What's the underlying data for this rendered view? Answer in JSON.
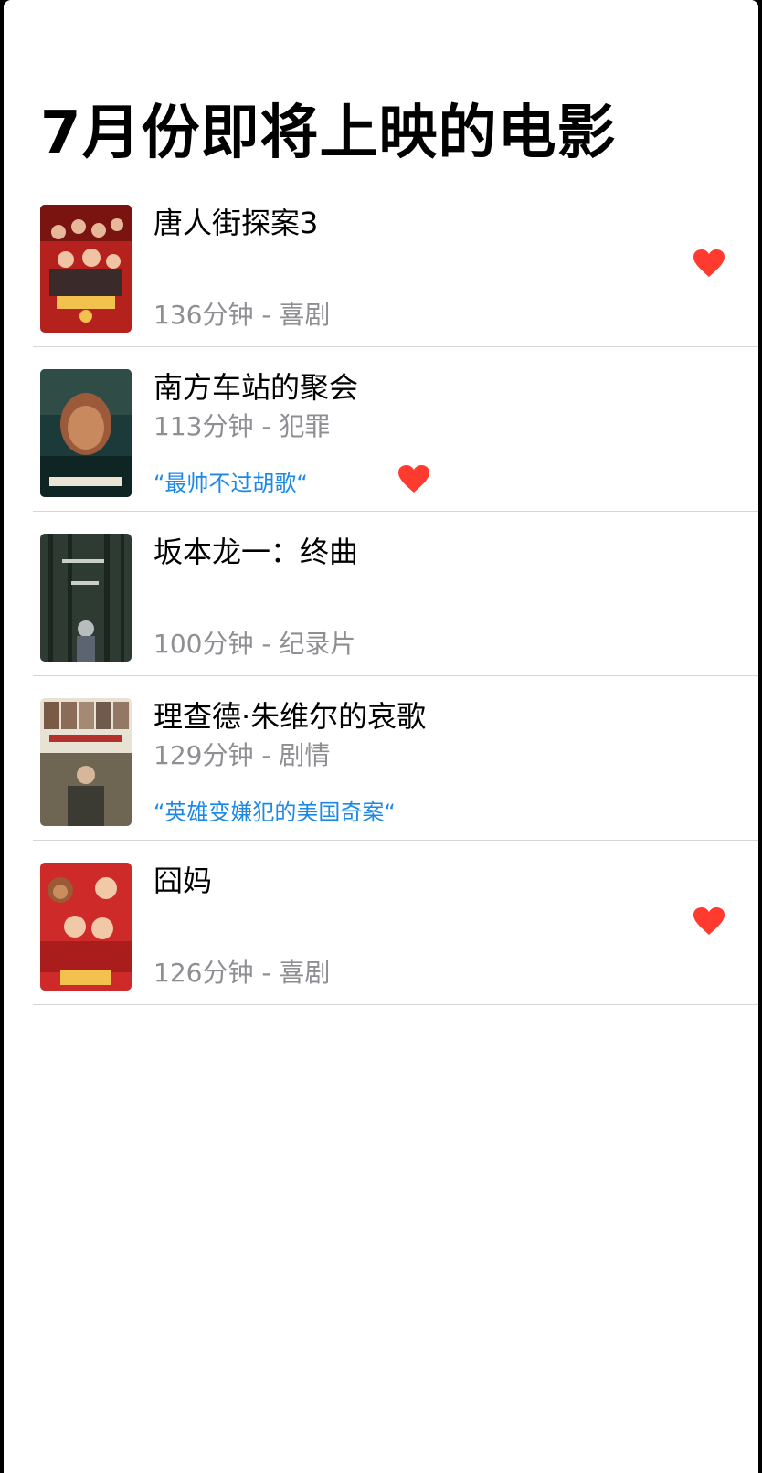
{
  "page": {
    "title": "7月份即将上映的电影"
  },
  "colors": {
    "accent_quote": "#1e88e5",
    "heart": "#ff3b30",
    "secondary_text": "#8e8e93",
    "divider": "#d6d6d8"
  },
  "movies": [
    {
      "title": "唐人街探案3",
      "meta": "136分钟 - 喜剧",
      "quote": "",
      "favorited": true,
      "poster_icon": "poster-tangrenjie"
    },
    {
      "title": "南方车站的聚会",
      "meta": "113分钟 - 犯罪",
      "quote": "“最帅不过胡歌“",
      "favorited": true,
      "poster_icon": "poster-nanfang"
    },
    {
      "title": "坂本龙一：终曲",
      "meta": "100分钟 - 纪录片",
      "quote": "",
      "favorited": false,
      "poster_icon": "poster-sakamoto"
    },
    {
      "title": "理查德·朱维尔的哀歌",
      "meta": "129分钟 - 剧情",
      "quote": "“英雄变嫌犯的美国奇案“",
      "favorited": false,
      "poster_icon": "poster-richard-jewell"
    },
    {
      "title": "囧妈",
      "meta": "126分钟 - 喜剧",
      "quote": "",
      "favorited": true,
      "poster_icon": "poster-jiongma"
    }
  ]
}
